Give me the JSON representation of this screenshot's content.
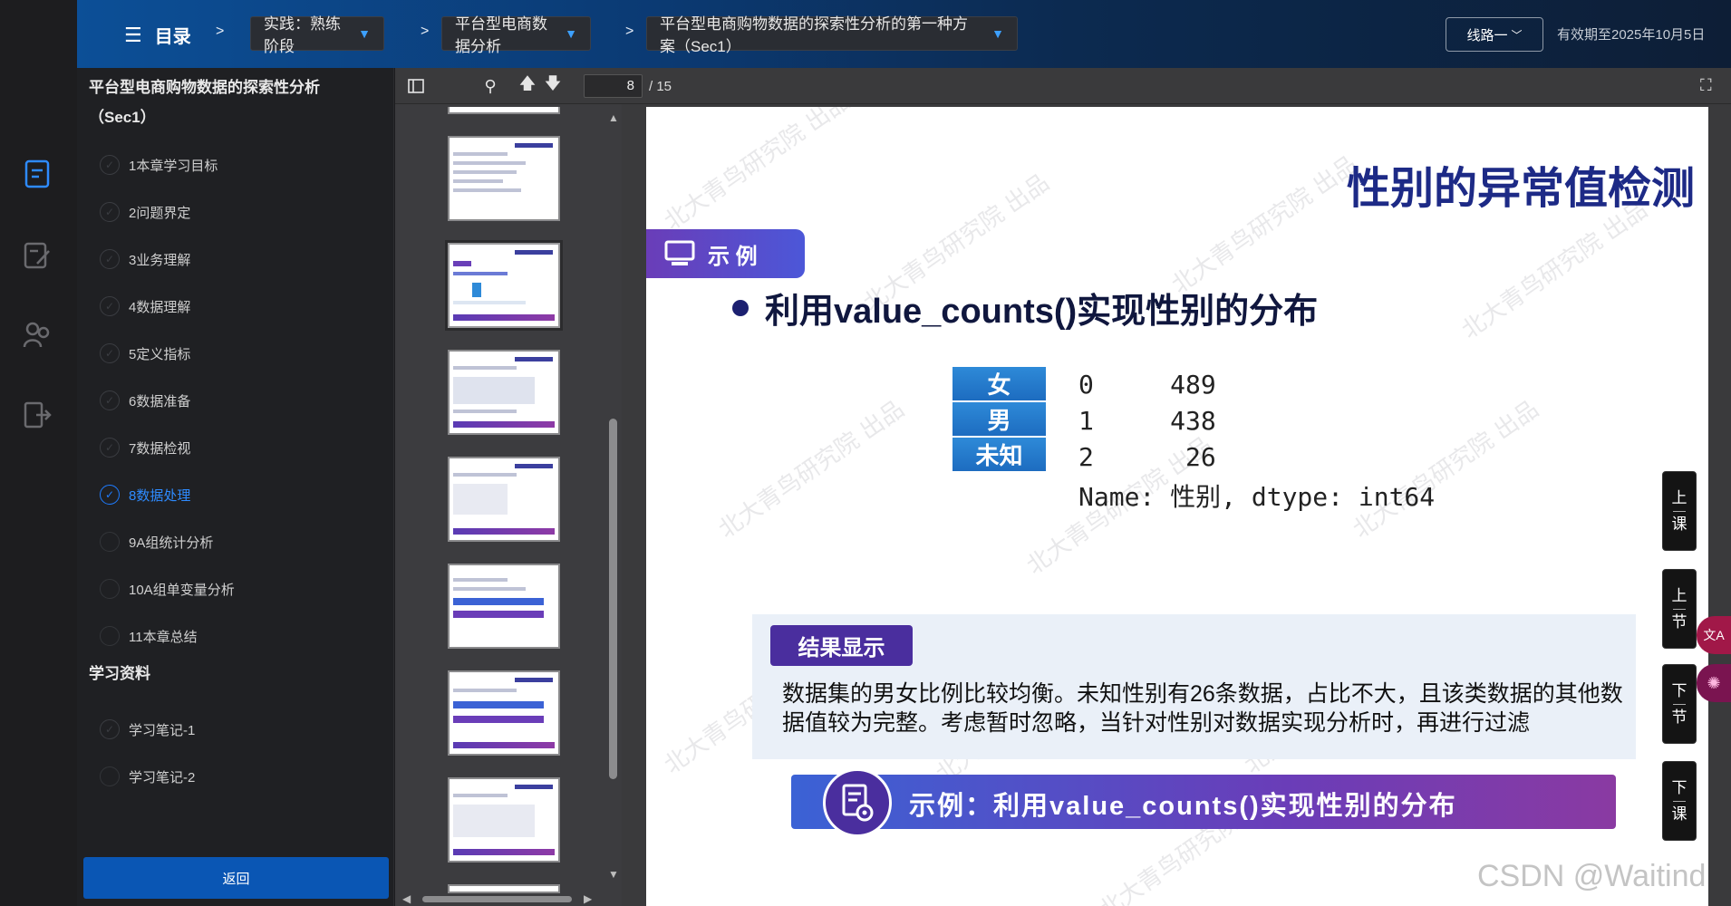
{
  "topbar": {
    "menu_label": "目录",
    "breadcrumbs": [
      {
        "label": "实践：熟练阶段"
      },
      {
        "label": "平台型电商数据分析"
      },
      {
        "label": "平台型电商购物数据的探索性分析的第一种方案（Sec1）"
      }
    ],
    "route_label": "线路一",
    "expiry": "有效期至2025年10月5日"
  },
  "sidebar": {
    "course_title": "平台型电商购物数据的探索性分析（Sec1）",
    "items": [
      {
        "label": "1本章学习目标"
      },
      {
        "label": "2问题界定"
      },
      {
        "label": "3业务理解"
      },
      {
        "label": "4数据理解"
      },
      {
        "label": "5定义指标"
      },
      {
        "label": "6数据准备"
      },
      {
        "label": "7数据检视"
      },
      {
        "label": "8数据处理"
      },
      {
        "label": "9A组统计分析"
      },
      {
        "label": "10A组单变量分析"
      },
      {
        "label": "11本章总结"
      }
    ],
    "active_index": 7,
    "materials_title": "学习资料",
    "materials": [
      {
        "label": "学习笔记-1"
      },
      {
        "label": "学习笔记-2"
      }
    ],
    "back_label": "返回"
  },
  "viewer": {
    "page_current": "8",
    "page_total": "/ 15"
  },
  "slide": {
    "title": "性别的异常值检测",
    "example_tab": "示 例",
    "bullet": "利用value_counts()实现性别的分布",
    "rows": [
      {
        "label": "女",
        "code": "0     489"
      },
      {
        "label": "男",
        "code": "1     438"
      },
      {
        "label": "未知",
        "code": "2      26"
      }
    ],
    "code_footer": "Name: 性别, dtype: int64",
    "result_tab": "结果显示",
    "result_text": "数据集的男女比例比较均衡。未知性别有26条数据，占比不大，且该类数据的其他数据值较为完整。考虑暂时忽略，当针对性别对数据实现分析时，再进行过滤",
    "footer_text": "示例：利用value_counts()实现性别的分布",
    "watermark": "北大青鸟研究院 出品"
  },
  "side_nav": [
    {
      "top": "上",
      "bottom": "课"
    },
    {
      "top": "上",
      "bottom": "节"
    },
    {
      "top": "下",
      "bottom": "节"
    },
    {
      "top": "下",
      "bottom": "课"
    }
  ],
  "translate_badge": "文A",
  "csdn_mark": "CSDN @Waitind"
}
